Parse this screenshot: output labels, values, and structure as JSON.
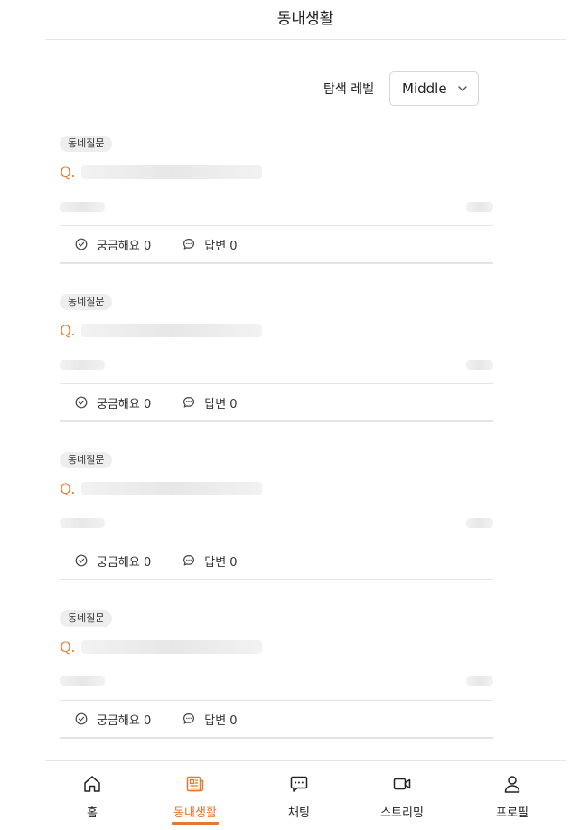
{
  "header": {
    "title": "동내생활"
  },
  "filter": {
    "label": "탐색 레벨",
    "selected": "Middle"
  },
  "posts": [
    {
      "tag": "동네질문",
      "q_mark": "Q.",
      "curious_label": "궁금해요 0",
      "answer_label": "답변 0"
    },
    {
      "tag": "동네질문",
      "q_mark": "Q.",
      "curious_label": "궁금해요 0",
      "answer_label": "답변 0"
    },
    {
      "tag": "동네질문",
      "q_mark": "Q.",
      "curious_label": "궁금해요 0",
      "answer_label": "답변 0"
    },
    {
      "tag": "동네질문",
      "q_mark": "Q.",
      "curious_label": "궁금해요 0",
      "answer_label": "답변 0"
    }
  ],
  "tabbar": {
    "items": [
      {
        "label": "홈",
        "icon": "home-icon"
      },
      {
        "label": "동내생활",
        "icon": "newspaper-icon",
        "active": true
      },
      {
        "label": "채팅",
        "icon": "chat-icon"
      },
      {
        "label": "스트리밍",
        "icon": "video-icon"
      },
      {
        "label": "프로필",
        "icon": "profile-icon"
      }
    ]
  },
  "colors": {
    "accent": "#e8762c",
    "divider": "#e6e6e6",
    "skeleton": "#ececec"
  }
}
